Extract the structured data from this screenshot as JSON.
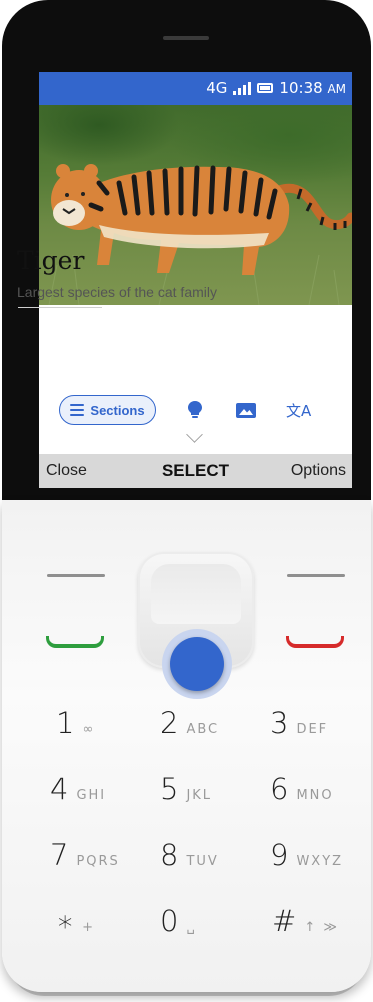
{
  "status_bar": {
    "network": "4G",
    "time": "10:38",
    "ampm": "AM"
  },
  "article": {
    "title": "Tiger",
    "subtitle": "Largest species of the cat family",
    "image_alt": "Tiger walking through grass",
    "actions": [
      {
        "label": "Sections",
        "icon": "list-icon"
      },
      {
        "label": "",
        "icon": "lightbulb-icon"
      },
      {
        "label": "",
        "icon": "image-icon"
      },
      {
        "label": "文A",
        "icon": "translate-icon"
      }
    ]
  },
  "softkeys": {
    "left": "Close",
    "center": "SELECT",
    "right": "Options"
  },
  "keypad": [
    {
      "num": "1",
      "letters": "∞"
    },
    {
      "num": "2",
      "letters": "ABC"
    },
    {
      "num": "3",
      "letters": "DEF"
    },
    {
      "num": "4",
      "letters": "GHI"
    },
    {
      "num": "5",
      "letters": "JKL"
    },
    {
      "num": "6",
      "letters": "MNO"
    },
    {
      "num": "7",
      "letters": "PQRS"
    },
    {
      "num": "8",
      "letters": "TUV"
    },
    {
      "num": "9",
      "letters": "WXYZ"
    },
    {
      "num": "∗",
      "letters": "+"
    },
    {
      "num": "0",
      "letters": "␣"
    },
    {
      "num": "#",
      "letters": "↑ ≫"
    }
  ],
  "colors": {
    "accent": "#3366cc",
    "call_green": "#2e9e3e",
    "end_red": "#d62b2b"
  }
}
